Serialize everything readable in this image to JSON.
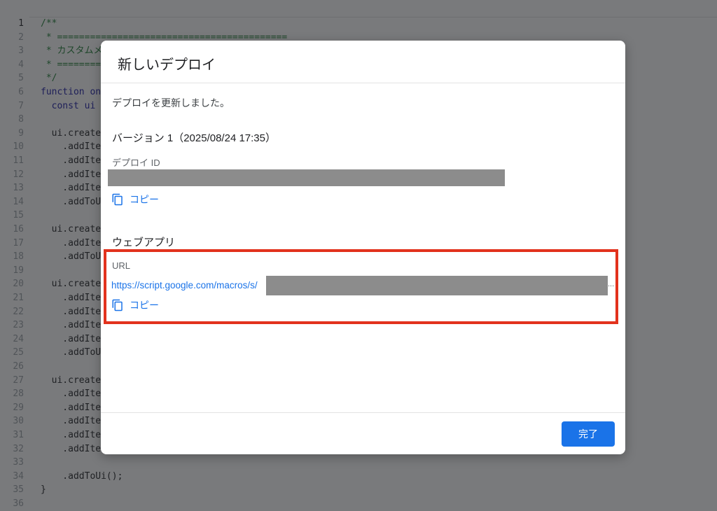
{
  "editor": {
    "line_numbers": [
      "1",
      "2",
      "3",
      "4",
      "5",
      "6",
      "7",
      "8",
      "9",
      "10",
      "11",
      "12",
      "13",
      "14",
      "15",
      "16",
      "17",
      "18",
      "19",
      "20",
      "21",
      "22",
      "23",
      "24",
      "25",
      "26",
      "27",
      "28",
      "29",
      "30",
      "31",
      "32",
      "33",
      "34",
      "35",
      "36"
    ],
    "visible_code": [
      {
        "line": 1,
        "text": "/**",
        "kind": "comment"
      },
      {
        "line": 2,
        "text": " * ==========================================",
        "kind": "comment"
      },
      {
        "line": 3,
        "text": " * カスタムメ",
        "kind": "comment"
      },
      {
        "line": 4,
        "text": " * =========",
        "kind": "comment"
      },
      {
        "line": 5,
        "text": " */",
        "kind": "comment"
      },
      {
        "line": 6,
        "text": "function onO",
        "kind": "keyword"
      },
      {
        "line": 7,
        "text": "  const ui =",
        "kind": "keyword"
      },
      {
        "line": 9,
        "text": "  ui.createM",
        "kind": "code"
      },
      {
        "line": 10,
        "text": "    .addIte",
        "kind": "code"
      },
      {
        "line": 11,
        "text": "    .addIte",
        "kind": "code"
      },
      {
        "line": 12,
        "text": "    .addIte",
        "kind": "code"
      },
      {
        "line": 13,
        "text": "    .addIte",
        "kind": "code"
      },
      {
        "line": 14,
        "text": "    .addToUi",
        "kind": "code"
      },
      {
        "line": 16,
        "text": "  ui.createM",
        "kind": "code"
      },
      {
        "line": 17,
        "text": "    .addIte",
        "kind": "code"
      },
      {
        "line": 18,
        "text": "    .addToUi",
        "kind": "code"
      },
      {
        "line": 20,
        "text": "  ui.createM",
        "kind": "code"
      },
      {
        "line": 21,
        "text": "    .addIte",
        "kind": "code"
      },
      {
        "line": 22,
        "text": "    .addIte",
        "kind": "code"
      },
      {
        "line": 23,
        "text": "    .addIte",
        "kind": "code"
      },
      {
        "line": 24,
        "text": "    .addIte",
        "kind": "code"
      },
      {
        "line": 25,
        "text": "    .addToUi",
        "kind": "code"
      },
      {
        "line": 27,
        "text": "  ui.createM",
        "kind": "code"
      },
      {
        "line": 28,
        "text": "    .addIte",
        "kind": "code"
      },
      {
        "line": 29,
        "text": "    .addIte",
        "kind": "code"
      },
      {
        "line": 30,
        "text": "    .addIte",
        "kind": "code"
      },
      {
        "line": 31,
        "text": "    .addIte",
        "kind": "code"
      },
      {
        "line": 32,
        "text": "    .addIte",
        "kind": "code"
      },
      {
        "line": 34,
        "text": "    .addToUi();",
        "kind": "code"
      },
      {
        "line": 35,
        "text": "}",
        "kind": "code"
      }
    ]
  },
  "dialog": {
    "title": "新しいデプロイ",
    "message": "デプロイを更新しました。",
    "version": "バージョン 1（2025/08/24 17:35）",
    "deploy_id_label": "デプロイ ID",
    "copy_label": "コピー",
    "webapp_section": "ウェブアプリ",
    "url_label": "URL",
    "url_prefix": "https://script.google.com/macros/s/",
    "url_truncation": "...",
    "done_label": "完了"
  },
  "colors": {
    "accent": "#1a73e8",
    "highlight_border": "#e2321d",
    "redaction": "#8c8c8c"
  }
}
